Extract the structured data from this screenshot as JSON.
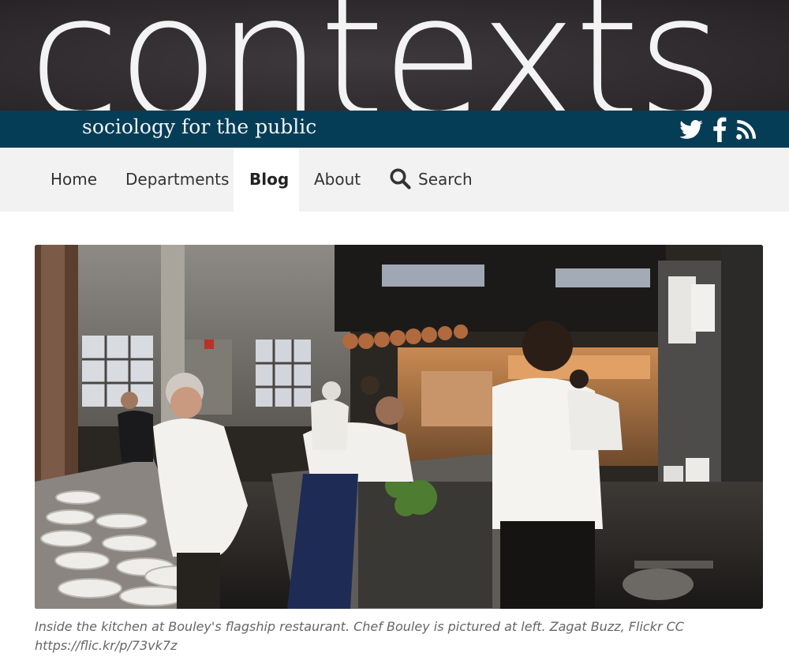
{
  "site": {
    "logo_text": "contexts",
    "tagline": "sociology for the public",
    "colors": {
      "masthead": "#2f2b2e",
      "tagline_bar": "#053d56",
      "nav_bg": "#f2f2f2"
    },
    "social_icons": [
      "twitter-icon",
      "facebook-icon",
      "rss-icon"
    ]
  },
  "nav": {
    "items": [
      {
        "label": "Home"
      },
      {
        "label": "Departments"
      },
      {
        "label": "Blog",
        "active": true
      },
      {
        "label": "About"
      },
      {
        "label": "Search",
        "icon": "search-icon"
      }
    ]
  },
  "article": {
    "image_icon": "kitchen-photo",
    "caption": "Inside the kitchen at Bouley's flagship restaurant. Chef Bouley is pictured at left. Zagat Buzz, Flickr CC https://flic.kr/p/73vk7z"
  }
}
